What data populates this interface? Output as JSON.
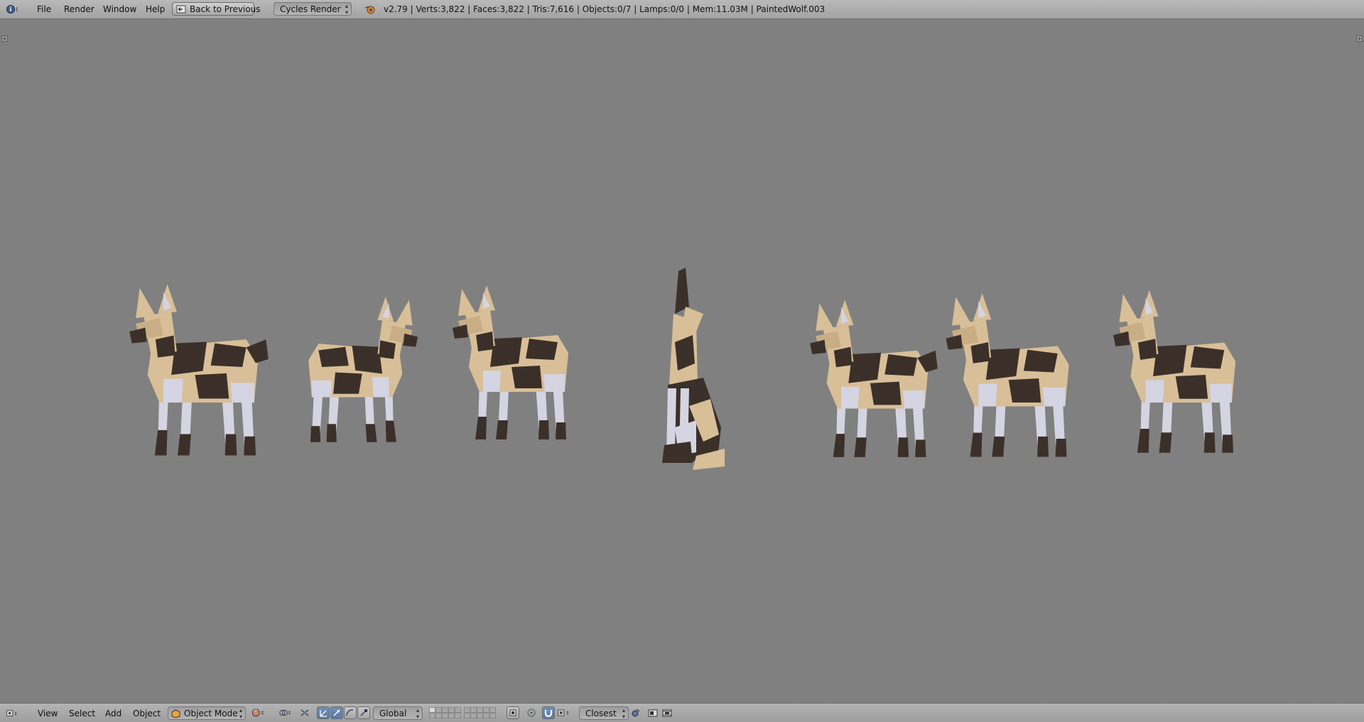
{
  "topbar": {
    "menus": [
      "File",
      "Render",
      "Window",
      "Help"
    ],
    "back_button": "Back to Previous",
    "render_engine": "Cycles Render",
    "stats": "v2.79 | Verts:3,822 | Faces:3,822 | Tris:7,616 | Objects:0/7 | Lamps:0/0 | Mem:11.03M | PaintedWolf.003"
  },
  "viewport": {
    "background": "#808080",
    "objects_visible": 7,
    "colors": {
      "tan": "#d8bf98",
      "dark": "#3b3029",
      "white": "#d4d4e2"
    }
  },
  "bottombar": {
    "menus": [
      "View",
      "Select",
      "Add",
      "Object"
    ],
    "mode": "Object Mode",
    "orientation": "Global",
    "snap_target": "Closest"
  }
}
